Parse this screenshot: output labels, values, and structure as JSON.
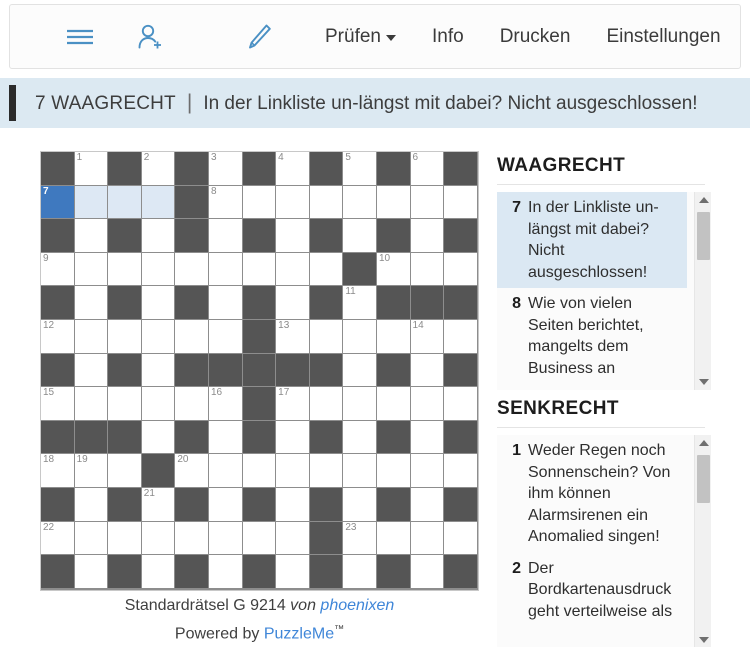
{
  "toolbar": {
    "menu_icon": "hamburger-menu-icon",
    "adduser_icon": "add-user-icon",
    "pencil_icon": "pencil-icon",
    "check_label": "Prüfen",
    "info_label": "Info",
    "print_label": "Drucken",
    "settings_label": "Einstellungen"
  },
  "clue_banner": {
    "number_label": "7 WAAGRECHT",
    "separator": "|",
    "text": "In der Linkliste un-längst mit dabei? Nicht ausgeschlossen!"
  },
  "footer": {
    "puzzle_title": "Standardrätsel G 9214",
    "by_word": "von",
    "author": "phoenixen",
    "powered_prefix": "Powered by",
    "powered_brand": "PuzzleMe",
    "trademark": "™"
  },
  "across": {
    "heading": "WAAGRECHT",
    "clues": [
      {
        "number": "7",
        "text": "In der Linkliste un-längst mit dabei? Nicht ausgeschlossen!",
        "active": true
      },
      {
        "number": "8",
        "text": "Wie von vielen Seiten berichtet, mangelts dem Business an",
        "active": false
      }
    ]
  },
  "down": {
    "heading": "SENKRECHT",
    "clues": [
      {
        "number": "1",
        "text": "Weder Regen noch Sonnenschein? Von ihm können Alarmsirenen ein Anomalied singen!",
        "active": false
      },
      {
        "number": "2",
        "text": "Der Bordkartenausdruck geht verteilweise als",
        "active": false
      }
    ]
  },
  "colors": {
    "accent_blue": "#3f79bf",
    "highlight_blue": "#dde8f4",
    "banner_blue": "#dce9f2",
    "block_gray": "#555555",
    "icon_blue": "#4a90c4",
    "link_blue": "#3f86d8"
  },
  "grid": {
    "rows": 13,
    "cols": 13,
    "selected": {
      "row": 1,
      "col": 0
    },
    "highlighted": [
      {
        "row": 1,
        "col": 1
      },
      {
        "row": 1,
        "col": 2
      },
      {
        "row": 1,
        "col": 3
      }
    ],
    "cells": [
      [
        {
          "b": true
        },
        {
          "n": "1"
        },
        {
          "b": true
        },
        {
          "n": "2"
        },
        {
          "b": true
        },
        {
          "n": "3"
        },
        {
          "b": true
        },
        {
          "n": "4"
        },
        {
          "b": true
        },
        {
          "n": "5"
        },
        {
          "b": true
        },
        {
          "n": "6"
        },
        {
          "b": true
        }
      ],
      [
        {
          "n": "7",
          "s": true
        },
        {
          "h": true
        },
        {
          "h": true
        },
        {
          "h": true
        },
        {
          "b": true
        },
        {
          "n": "8"
        },
        {},
        {},
        {},
        {},
        {},
        {},
        {}
      ],
      [
        {
          "b": true
        },
        {},
        {
          "b": true
        },
        {},
        {
          "b": true
        },
        {},
        {
          "b": true
        },
        {},
        {
          "b": true
        },
        {},
        {
          "b": true
        },
        {},
        {
          "b": true
        }
      ],
      [
        {
          "n": "9"
        },
        {},
        {},
        {},
        {},
        {},
        {},
        {},
        {},
        {
          "b": true
        },
        {
          "n": "10"
        },
        {},
        {}
      ],
      [
        {
          "b": true
        },
        {},
        {
          "b": true
        },
        {},
        {
          "b": true
        },
        {},
        {
          "b": true
        },
        {},
        {
          "b": true
        },
        {
          "n": "11"
        },
        {
          "b": true
        },
        {
          "b": true
        },
        {
          "b": true
        }
      ],
      [
        {
          "n": "12"
        },
        {},
        {},
        {},
        {},
        {},
        {
          "b": true
        },
        {
          "n": "13"
        },
        {},
        {},
        {},
        {
          "n": "14"
        },
        {}
      ],
      [
        {
          "b": true
        },
        {},
        {
          "b": true
        },
        {},
        {
          "b": true
        },
        {
          "b": true
        },
        {
          "b": true
        },
        {
          "b": true
        },
        {
          "b": true
        },
        {},
        {
          "b": true
        },
        {},
        {
          "b": true
        }
      ],
      [
        {
          "n": "15"
        },
        {},
        {},
        {},
        {},
        {
          "n": "16"
        },
        {
          "b": true
        },
        {
          "n": "17"
        },
        {},
        {},
        {},
        {},
        {}
      ],
      [
        {
          "b": true
        },
        {
          "b": true
        },
        {
          "b": true
        },
        {},
        {
          "b": true
        },
        {},
        {
          "b": true
        },
        {},
        {
          "b": true
        },
        {},
        {
          "b": true
        },
        {},
        {
          "b": true
        }
      ],
      [
        {
          "n": "18"
        },
        {
          "n": "19"
        },
        {},
        {
          "b": true
        },
        {
          "n": "20"
        },
        {},
        {},
        {},
        {},
        {},
        {},
        {},
        {}
      ],
      [
        {
          "b": true
        },
        {},
        {
          "b": true
        },
        {
          "n": "21"
        },
        {
          "b": true
        },
        {},
        {
          "b": true
        },
        {},
        {
          "b": true
        },
        {},
        {
          "b": true
        },
        {},
        {
          "b": true
        }
      ],
      [
        {
          "n": "22"
        },
        {},
        {},
        {},
        {},
        {},
        {},
        {},
        {
          "b": true
        },
        {
          "n": "23"
        },
        {},
        {},
        {}
      ],
      [
        {
          "b": true
        },
        {},
        {
          "b": true
        },
        {},
        {
          "b": true
        },
        {},
        {
          "b": true
        },
        {},
        {
          "b": true
        },
        {},
        {
          "b": true
        },
        {},
        {
          "b": true
        }
      ]
    ]
  }
}
